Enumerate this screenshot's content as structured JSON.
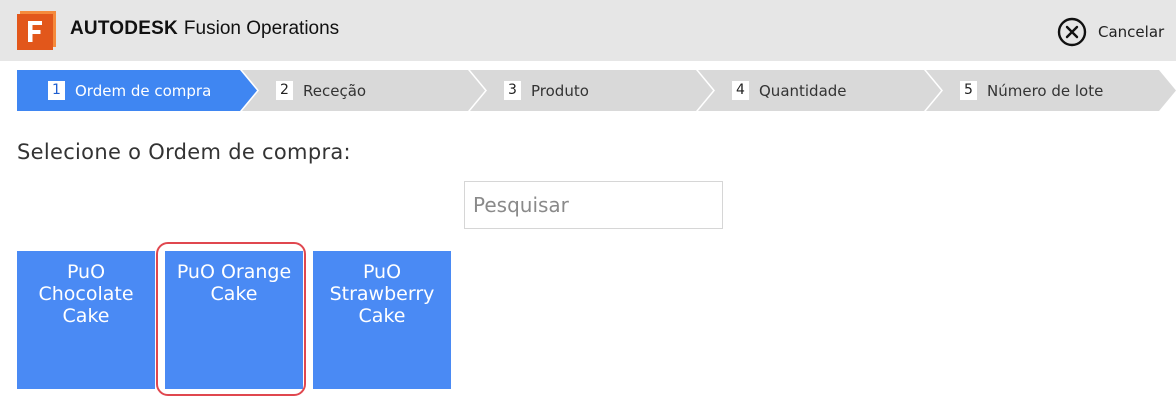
{
  "header": {
    "brand": "AUTODESK",
    "product": "Fusion Operations",
    "logo_letter": "F",
    "cancel_label": "Cancelar"
  },
  "steps": [
    {
      "number": "1",
      "label": "Ordem de compra",
      "active": true
    },
    {
      "number": "2",
      "label": "Receção",
      "active": false
    },
    {
      "number": "3",
      "label": "Produto",
      "active": false
    },
    {
      "number": "4",
      "label": "Quantidade",
      "active": false
    },
    {
      "number": "5",
      "label": "Número de lote",
      "active": false
    }
  ],
  "prompt": "Selecione o Ordem de compra:",
  "search": {
    "placeholder": "Pesquisar",
    "value": ""
  },
  "tiles": [
    {
      "label": "PuO Chocolate Cake",
      "highlighted": false
    },
    {
      "label": "PuO Orange Cake",
      "highlighted": true
    },
    {
      "label": "PuO Strawberry Cake",
      "highlighted": false
    }
  ],
  "colors": {
    "header_bg": "#e6e6e6",
    "step_active": "#3f86f2",
    "step_inactive": "#d9d9d9",
    "tile": "#4a8af4",
    "highlight": "#e0474f",
    "logo": "#f26a21"
  }
}
